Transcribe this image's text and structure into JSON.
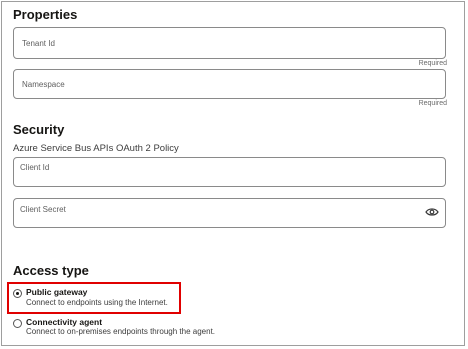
{
  "properties": {
    "heading": "Properties",
    "tenant_id": {
      "label": "Tenant Id",
      "required": "Required"
    },
    "namespace": {
      "label": "Namespace",
      "required": "Required"
    }
  },
  "security": {
    "heading": "Security",
    "policy": "Azure Service Bus APIs OAuth 2 Policy",
    "client_id": {
      "label": "Client Id"
    },
    "client_secret": {
      "label": "Client Secret",
      "icon": "eye-icon"
    }
  },
  "access_type": {
    "heading": "Access type",
    "options": [
      {
        "title": "Public gateway",
        "description": "Connect to endpoints using the Internet.",
        "selected": true
      },
      {
        "title": "Connectivity agent",
        "description": "Connect to on-premises endpoints through the agent.",
        "selected": false
      }
    ],
    "highlight_color": "#e00000"
  }
}
